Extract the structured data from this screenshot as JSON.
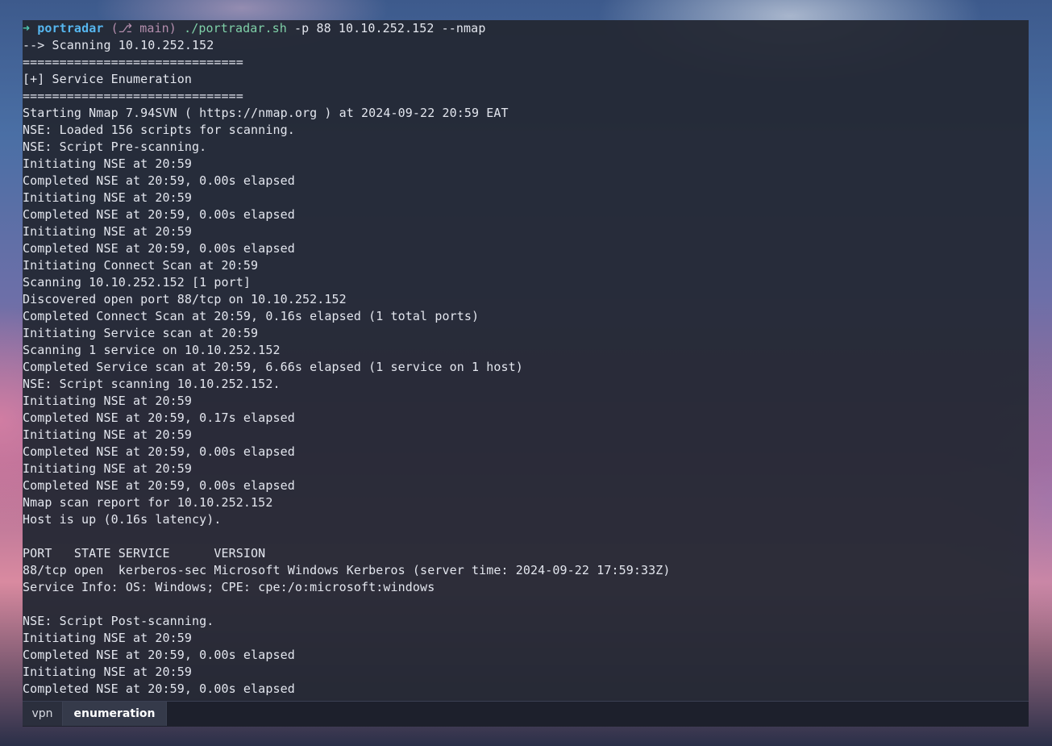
{
  "prompt": {
    "arrow": "➜",
    "dir": "portradar",
    "git": "(⎇ main)",
    "command": "./portradar.sh",
    "args": "-p 88 10.10.252.152 --nmap"
  },
  "output_lines": [
    "--> Scanning 10.10.252.152",
    "==============================",
    "[+] Service Enumeration",
    "==============================",
    "Starting Nmap 7.94SVN ( https://nmap.org ) at 2024-09-22 20:59 EAT",
    "NSE: Loaded 156 scripts for scanning.",
    "NSE: Script Pre-scanning.",
    "Initiating NSE at 20:59",
    "Completed NSE at 20:59, 0.00s elapsed",
    "Initiating NSE at 20:59",
    "Completed NSE at 20:59, 0.00s elapsed",
    "Initiating NSE at 20:59",
    "Completed NSE at 20:59, 0.00s elapsed",
    "Initiating Connect Scan at 20:59",
    "Scanning 10.10.252.152 [1 port]",
    "Discovered open port 88/tcp on 10.10.252.152",
    "Completed Connect Scan at 20:59, 0.16s elapsed (1 total ports)",
    "Initiating Service scan at 20:59",
    "Scanning 1 service on 10.10.252.152",
    "Completed Service scan at 20:59, 6.66s elapsed (1 service on 1 host)",
    "NSE: Script scanning 10.10.252.152.",
    "Initiating NSE at 20:59",
    "Completed NSE at 20:59, 0.17s elapsed",
    "Initiating NSE at 20:59",
    "Completed NSE at 20:59, 0.00s elapsed",
    "Initiating NSE at 20:59",
    "Completed NSE at 20:59, 0.00s elapsed",
    "Nmap scan report for 10.10.252.152",
    "Host is up (0.16s latency).",
    "",
    "PORT   STATE SERVICE      VERSION",
    "88/tcp open  kerberos-sec Microsoft Windows Kerberos (server time: 2024-09-22 17:59:33Z)",
    "Service Info: OS: Windows; CPE: cpe:/o:microsoft:windows",
    "",
    "NSE: Script Post-scanning.",
    "Initiating NSE at 20:59",
    "Completed NSE at 20:59, 0.00s elapsed",
    "Initiating NSE at 20:59",
    "Completed NSE at 20:59, 0.00s elapsed"
  ],
  "tabs": [
    {
      "label": "vpn",
      "active": false
    },
    {
      "label": "enumeration",
      "active": true
    }
  ]
}
